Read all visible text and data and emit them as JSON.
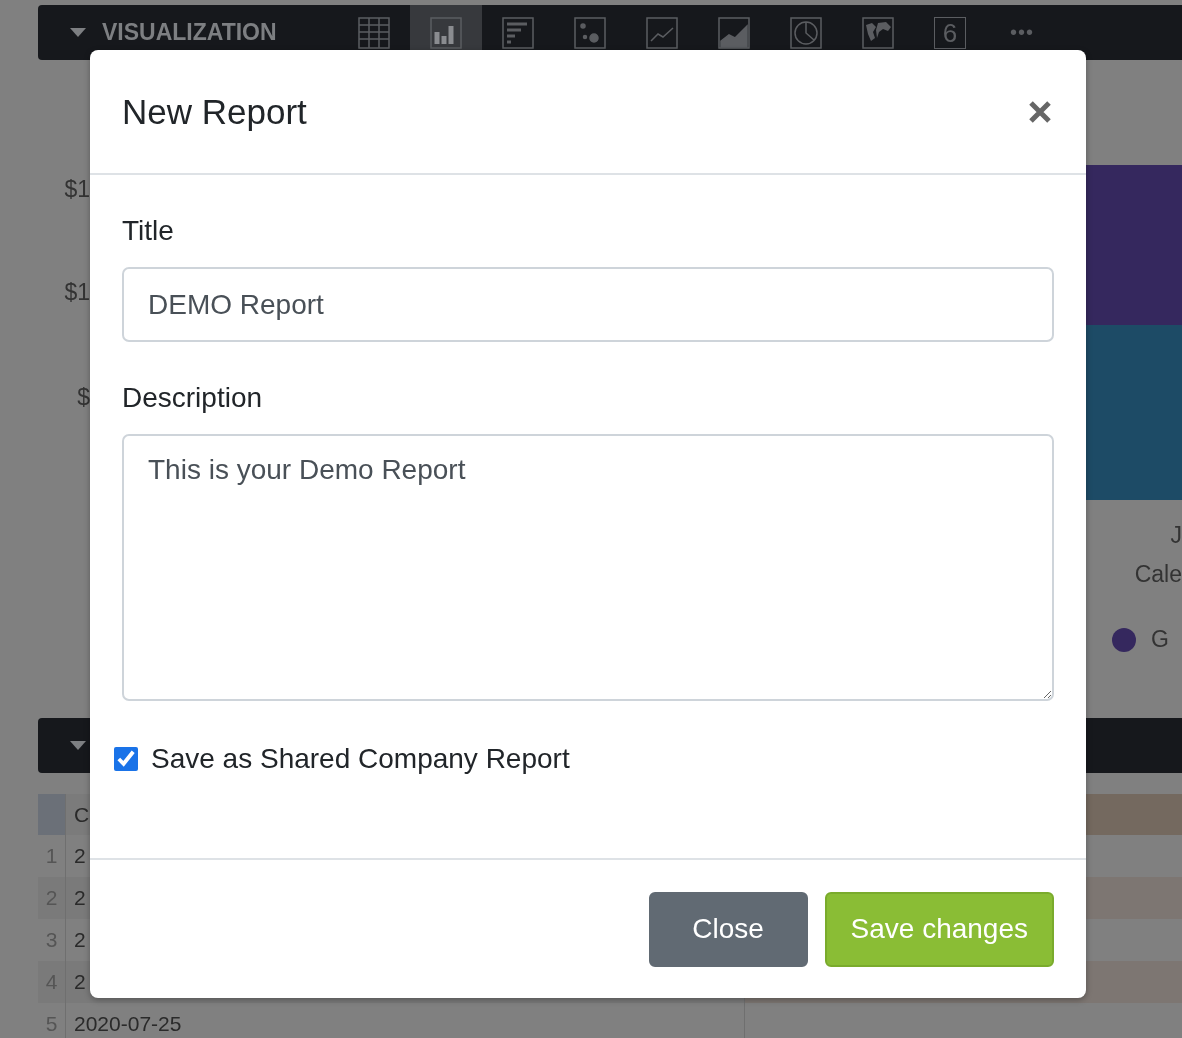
{
  "toolbar": {
    "title": "VISUALIZATION",
    "chart_types": [
      {
        "kind": "table",
        "selected": false
      },
      {
        "kind": "bar",
        "selected": true
      },
      {
        "kind": "hbar",
        "selected": false
      },
      {
        "kind": "scatter",
        "selected": false
      },
      {
        "kind": "line",
        "selected": false
      },
      {
        "kind": "area",
        "selected": false
      },
      {
        "kind": "pie",
        "selected": false
      },
      {
        "kind": "map",
        "selected": false
      },
      {
        "kind": "number",
        "label": "6",
        "selected": false
      }
    ],
    "more": "•••"
  },
  "chart_background": {
    "y_labels": [
      "$1",
      "$1",
      "$"
    ],
    "x_labels": [
      "J",
      "Cale"
    ],
    "legend": [
      {
        "label": "G",
        "color": "#35285e"
      }
    ]
  },
  "table": {
    "header": "C",
    "rows": [
      {
        "number": "1",
        "cell": "2",
        "striped": false
      },
      {
        "number": "2",
        "cell": "2",
        "striped": true
      },
      {
        "number": "3",
        "cell": "2",
        "striped": false
      },
      {
        "number": "4",
        "cell": "2",
        "striped": true
      },
      {
        "number": "5",
        "cell": "2020-07-25",
        "striped": false
      }
    ]
  },
  "modal": {
    "title": "New Report",
    "fields": [
      {
        "kind": "input",
        "label": "Title",
        "value": "DEMO Report"
      },
      {
        "kind": "textarea",
        "label": "Description",
        "value": "This is your Demo Report"
      }
    ],
    "checkbox": {
      "label": "Save as Shared Company Report",
      "checked": true
    },
    "buttons": [
      {
        "kind": "secondary",
        "label": "Close"
      },
      {
        "kind": "primary",
        "label": "Save changes"
      }
    ]
  }
}
